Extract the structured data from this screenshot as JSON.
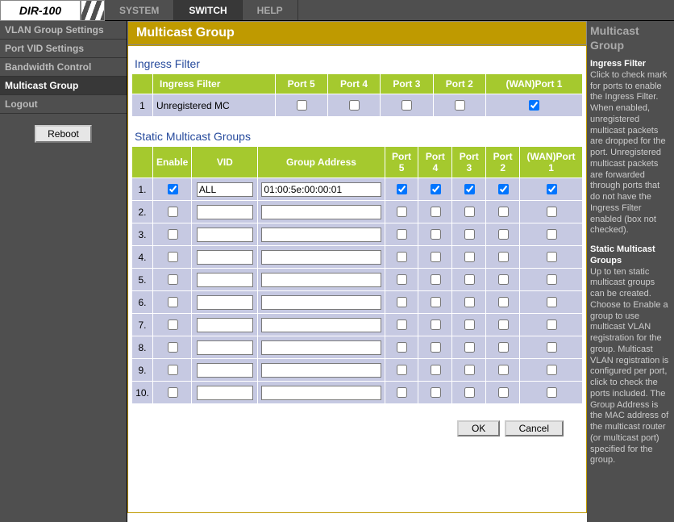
{
  "device_model": "DIR-100",
  "topnav": {
    "system": "SYSTEM",
    "switch": "SWITCH",
    "help": "HELP"
  },
  "sidebar": {
    "items": [
      "VLAN Group Settings",
      "Port VID Settings",
      "Bandwidth Control",
      "Multicast Group",
      "Logout"
    ],
    "reboot_label": "Reboot"
  },
  "page_title": "Multicast Group",
  "ingress": {
    "section_title": "Ingress Filter",
    "header_filter": "Ingress Filter",
    "ports": [
      "Port 5",
      "Port 4",
      "Port 3",
      "Port 2",
      "(WAN)Port 1"
    ],
    "row_label": "Unregistered MC",
    "row_num": "1",
    "checks": [
      false,
      false,
      false,
      false,
      true
    ]
  },
  "static_groups": {
    "section_title": "Static Multicast Groups",
    "headers": {
      "enable": "Enable",
      "vid": "VID",
      "address": "Group Address",
      "ports": [
        "Port 5",
        "Port 4",
        "Port 3",
        "Port 2",
        "(WAN)Port 1"
      ]
    },
    "rows": [
      {
        "n": "1.",
        "enable": true,
        "vid": "ALL",
        "addr": "01:00:5e:00:00:01",
        "p": [
          true,
          true,
          true,
          true,
          true
        ]
      },
      {
        "n": "2.",
        "enable": false,
        "vid": "",
        "addr": "",
        "p": [
          false,
          false,
          false,
          false,
          false
        ]
      },
      {
        "n": "3.",
        "enable": false,
        "vid": "",
        "addr": "",
        "p": [
          false,
          false,
          false,
          false,
          false
        ]
      },
      {
        "n": "4.",
        "enable": false,
        "vid": "",
        "addr": "",
        "p": [
          false,
          false,
          false,
          false,
          false
        ]
      },
      {
        "n": "5.",
        "enable": false,
        "vid": "",
        "addr": "",
        "p": [
          false,
          false,
          false,
          false,
          false
        ]
      },
      {
        "n": "6.",
        "enable": false,
        "vid": "",
        "addr": "",
        "p": [
          false,
          false,
          false,
          false,
          false
        ]
      },
      {
        "n": "7.",
        "enable": false,
        "vid": "",
        "addr": "",
        "p": [
          false,
          false,
          false,
          false,
          false
        ]
      },
      {
        "n": "8.",
        "enable": false,
        "vid": "",
        "addr": "",
        "p": [
          false,
          false,
          false,
          false,
          false
        ]
      },
      {
        "n": "9.",
        "enable": false,
        "vid": "",
        "addr": "",
        "p": [
          false,
          false,
          false,
          false,
          false
        ]
      },
      {
        "n": "10.",
        "enable": false,
        "vid": "",
        "addr": "",
        "p": [
          false,
          false,
          false,
          false,
          false
        ]
      }
    ]
  },
  "buttons": {
    "ok": "OK",
    "cancel": "Cancel"
  },
  "help": {
    "title": "Multicast Group",
    "h1": "Ingress Filter",
    "t1": "Click to check mark for ports to enable the Ingress Filter. When enabled, unregistered multicast packets are dropped for the port. Unregistered multicast packets are forwarded through ports that do not have the Ingress Filter enabled (box not checked).",
    "h2": "Static Multicast Groups",
    "t2": "Up to ten static multicast groups can be created. Choose to Enable a group to use multicast VLAN registration for the group. Multicast VLAN registration is configured per port, click to check the ports included. The Group Address is the MAC address of the multicast router (or multicast port) specified for the group."
  }
}
